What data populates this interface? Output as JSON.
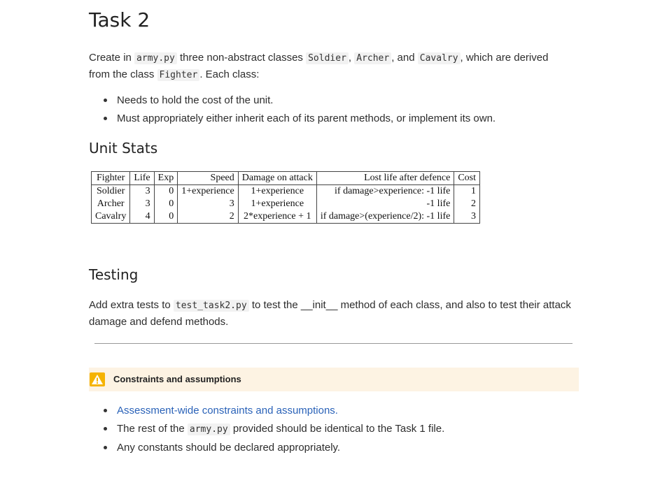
{
  "task": {
    "title": "Task 2",
    "intro": {
      "t1": "Create in ",
      "c1": "army.py",
      "t2": " three non-abstract classes ",
      "c2": "Soldier",
      "t3": ", ",
      "c3": "Archer",
      "t4": ", and ",
      "c4": "Cavalry",
      "t5": ", which are derived from the class ",
      "c5": "Fighter",
      "t6": ". Each class:"
    },
    "bullets": [
      "Needs to hold the cost of the unit.",
      "Must appropriately either inherit each of its parent methods, or implement its own."
    ]
  },
  "unit_stats": {
    "heading": "Unit Stats",
    "columns": [
      "Fighter",
      "Life",
      "Exp",
      "Speed",
      "Damage on attack",
      "Lost life after defence",
      "Cost"
    ],
    "rows": [
      [
        "Soldier",
        "3",
        "0",
        "1+experience",
        "1+experience",
        "if damage>experience: -1 life",
        "1"
      ],
      [
        "Archer",
        "3",
        "0",
        "3",
        "1+experience",
        "-1 life",
        "2"
      ],
      [
        "Cavalry",
        "4",
        "0",
        "2",
        "2*experience + 1",
        "if damage>(experience/2): -1 life",
        "3"
      ]
    ]
  },
  "testing": {
    "heading": "Testing",
    "t1": "Add extra tests to ",
    "c1": "test_task2.py",
    "t2": " to test the __init__ method of each class, and also to test their attack damage and defend methods."
  },
  "callout": {
    "title": "Constraints and assumptions",
    "link": "Assessment-wide constraints and assumptions.",
    "b2_t1": "The rest of the ",
    "b2_c1": "army.py",
    "b2_t2": " provided should be identical to the Task 1 file.",
    "b3": "Any constants should be declared appropriately."
  },
  "colors": {
    "link": "#2a62b8",
    "warning": "#f5b301",
    "callout_bg": "#fdf3e3"
  }
}
